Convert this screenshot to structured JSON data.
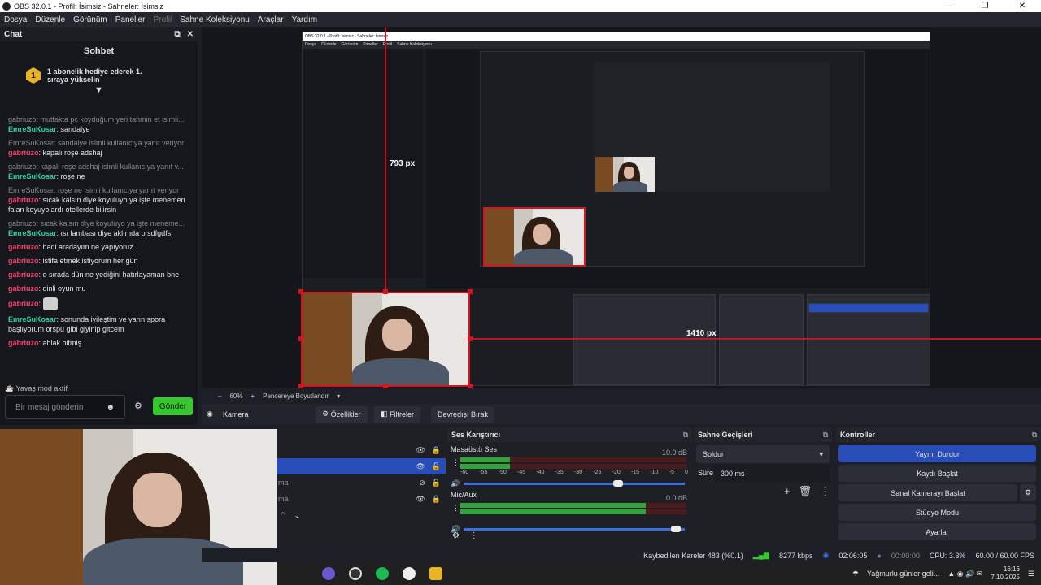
{
  "window": {
    "title": "OBS 32.0.1 - Profil: İsimsiz - Sahneler: İsimsiz"
  },
  "menu": [
    "Dosya",
    "Düzenle",
    "Görünüm",
    "Paneller",
    "Profil",
    "Sahne Koleksiyonu",
    "Araçlar",
    "Yardım"
  ],
  "chat": {
    "dock_title": "Chat",
    "title": "Sohbet",
    "pinned": "1 abonelik hediye ederek 1. sıraya yükselin",
    "pinned_rank": "1",
    "messages": [
      {
        "reply": "gabriuzo: mutfakta pc koyduğum yeri tahmin et isimli...",
        "user": "EmreSuKosar",
        "text": "sandalye"
      },
      {
        "reply": "EmreSuKosar: sandalye isimli kullanıcıya yanıt veriyor",
        "user": "gabriuzo",
        "text": "kapalı roşe adshaj"
      },
      {
        "reply": "gabriuzo: kapalı roşe adshaj isimli kullanıcıya yanıt v...",
        "user": "EmreSuKosar",
        "text": "roşe ne"
      },
      {
        "reply": "EmreSuKosar: roşe ne isimli kullanıcıya yanıt veriyor",
        "user": "gabriuzo",
        "text": "sıcak kalsın diye koyuluyo ya işte menemen falan koyuyolardı otellerde bilirsin"
      },
      {
        "reply": "gabriuzo: sıcak kalsın diye koyuluyo ya işte meneme...",
        "user": "EmreSuKosar",
        "text": "ısı lambası diye aklımda o sdfgdfs"
      },
      {
        "reply": "",
        "user": "gabriuzo",
        "text": "hadi aradayım ne yapıyoruz"
      },
      {
        "reply": "",
        "user": "gabriuzo",
        "text": "istifa etmek istiyorum her gün"
      },
      {
        "reply": "",
        "user": "gabriuzo",
        "text": "o sırada dün ne yediğini hatırlayaman bne"
      },
      {
        "reply": "",
        "user": "gabriuzo",
        "text": "dinli oyun mu"
      },
      {
        "reply": "",
        "user": "gabriuzo",
        "text": ""
      },
      {
        "reply": "",
        "user": "EmreSuKosar",
        "text": "sonunda iyileştim ve yarın spora başlıyorum orspu gibi giyinip gitcem"
      },
      {
        "reply": "",
        "user": "gabriuzo",
        "text": "ahlak bitmiş"
      }
    ],
    "slow_mode": "Yavaş mod aktif",
    "input_placeholder": "Bir mesaj gönderin",
    "send": "Gönder"
  },
  "preview": {
    "px_top": "793 px",
    "px_right": "1410 px"
  },
  "zoom": {
    "level": "60%",
    "mode": "Pencereye Boyutlandır"
  },
  "source_bar": {
    "name": "Kamera",
    "properties": "Özellikler",
    "filters": "Filtreler",
    "deactivate": "Devredışı Bırak"
  },
  "sources": {
    "rows": [
      "",
      "",
      "ma",
      "ma"
    ]
  },
  "mixer": {
    "title": "Ses Karıştırıcı",
    "channels": [
      {
        "name": "Masaüstü Ses",
        "db": "-10.0 dB",
        "level": 0.22,
        "volume": 0.7
      },
      {
        "name": "Mic/Aux",
        "db": "0.0 dB",
        "level": 0.82,
        "volume": 0.96
      }
    ],
    "scale": [
      "-60",
      "-55",
      "-50",
      "-45",
      "-40",
      "-35",
      "-30",
      "-25",
      "-20",
      "-15",
      "-10",
      "-5",
      "0"
    ]
  },
  "transitions": {
    "title": "Sahne Geçişleri",
    "selected": "Soldur",
    "duration_label": "Süre",
    "duration": "300 ms"
  },
  "controls": {
    "title": "Kontroller",
    "buttons": [
      "Yayını Durdur",
      "Kaydı Başlat",
      "Sanal Kamerayı Başlat",
      "Stüdyo Modu",
      "Ayarlar"
    ]
  },
  "status": {
    "dropped": "Kaybedilen Kareler 483 (%0.1)",
    "bitrate": "8277 kbps",
    "stream_time": "02:06:05",
    "rec_time": "00:00:00",
    "cpu": "CPU: 3.3%",
    "fps": "60.00 / 60.00 FPS"
  },
  "taskbar": {
    "weather": "Yağmurlu günler geli...",
    "time": "16:16",
    "date": "7.10.2025"
  },
  "colors": {
    "accent": "#284cb8",
    "send": "#35c92e",
    "user_red": "#fc3f6e",
    "user_green": "#35d4a2",
    "selection": "#d4151f"
  }
}
